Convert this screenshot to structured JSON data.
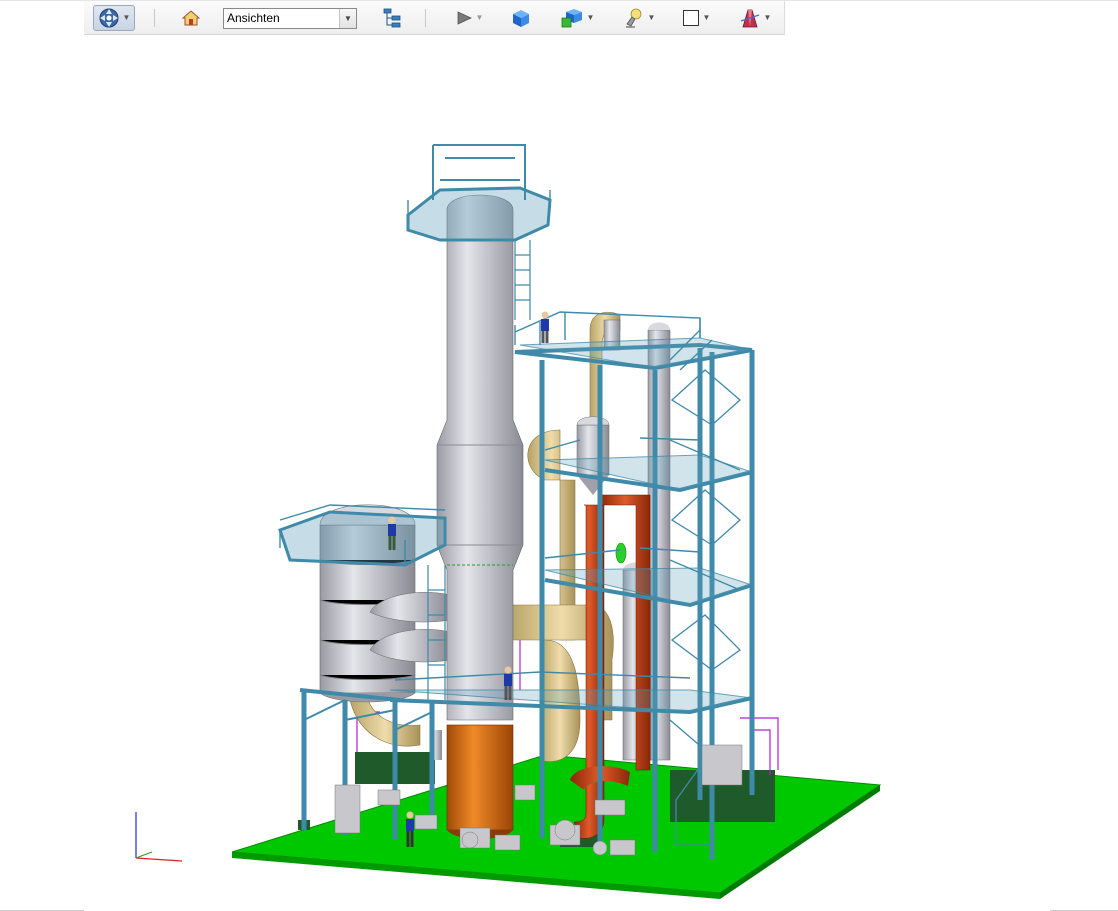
{
  "toolbar": {
    "items": [
      {
        "name": "navigation-wheel",
        "icon": "navigation-wheel-icon",
        "dropdown": true,
        "active": true
      },
      {
        "name": "home-view",
        "icon": "home-icon",
        "dropdown": false
      },
      {
        "name": "views-combo",
        "value": "Ansichten"
      },
      {
        "name": "model-browser",
        "icon": "tree-structure-icon",
        "dropdown": false
      },
      {
        "name": "play",
        "icon": "play-icon",
        "dropdown": true
      },
      {
        "name": "shaded-display",
        "icon": "cube-shaded-icon",
        "dropdown": false
      },
      {
        "name": "display-style",
        "icon": "cube-multi-icon",
        "dropdown": true
      },
      {
        "name": "lighting",
        "icon": "spotlight-icon",
        "dropdown": true
      },
      {
        "name": "background",
        "icon": "square-outline-icon",
        "dropdown": true
      },
      {
        "name": "section-plane",
        "icon": "section-plane-icon",
        "dropdown": true
      }
    ],
    "views_value": "Ansichten"
  },
  "viewport": {
    "content": "3d-plant-model",
    "ground_color": "#00c000",
    "steel_color": "#4a8aa5",
    "vessel_color": "#b8b8c0",
    "copper_color": "#d06a10",
    "hot_pipe_color": "#c04018",
    "tan_pipe_color": "#d8c48a"
  },
  "triad": {
    "axes": [
      "x",
      "y",
      "z"
    ],
    "colors": {
      "x": "#e02020",
      "y": "#20a020",
      "z": "#2030d0"
    }
  }
}
